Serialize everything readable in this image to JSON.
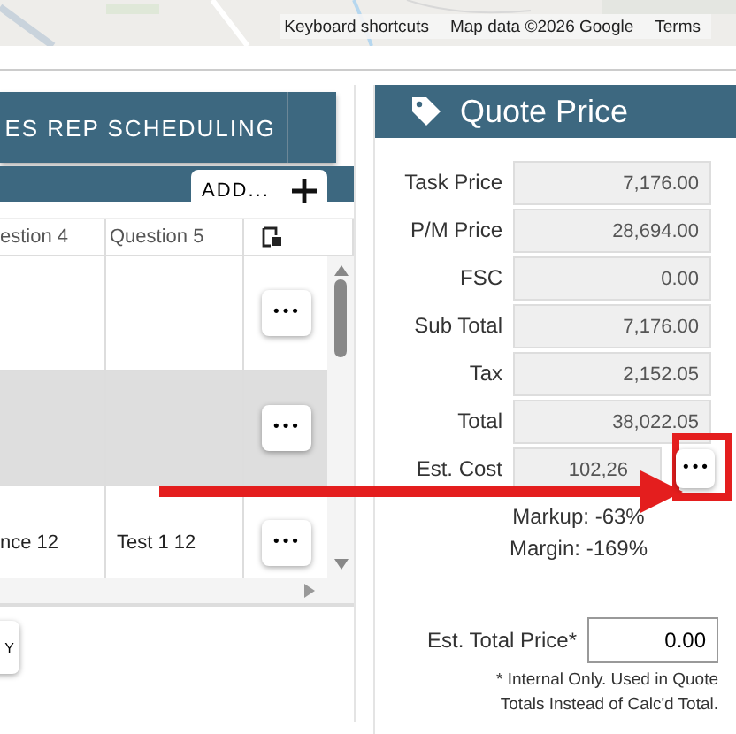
{
  "map": {
    "kind": "picture",
    "attribution": [
      "Keyboard shortcuts",
      "Map data ©2026 Google",
      "Terms"
    ]
  },
  "left_panel": {
    "tabs": [
      {
        "label": "ES REP SCHEDULING",
        "selected": true
      }
    ],
    "add_button": "ADD...",
    "table": {
      "columns": [
        "estion 4",
        "Question 5"
      ],
      "rows": [
        {
          "cells": [
            null,
            null
          ],
          "shaded": false
        },
        {
          "cells": [
            null,
            null
          ],
          "shaded": true
        },
        {
          "cells": [
            "nce 12",
            "Test 1 12"
          ],
          "shaded": false
        }
      ],
      "row_button": "•••"
    },
    "bottom_button": "Y"
  },
  "quote_price": {
    "title": "Quote Price",
    "fields": [
      {
        "label": "Task Price",
        "value": "7,176.00"
      },
      {
        "label": "P/M Price",
        "value": "28,694.00"
      },
      {
        "label": "FSC",
        "value": "0.00"
      },
      {
        "label": "Sub Total",
        "value": "7,176.00"
      },
      {
        "label": "Tax",
        "value": "2,152.05"
      },
      {
        "label": "Total",
        "value": "38,022.05"
      }
    ],
    "est_cost": {
      "label": "Est. Cost",
      "value": "102,26",
      "button": "•••"
    },
    "markup": "Markup: -63%",
    "margin": "Margin: -169%",
    "est_total_price": {
      "label": "Est. Total Price*",
      "value": "0.00"
    },
    "footnote": [
      "* Internal Only. Used in Quote",
      "Totals Instead of Calc'd Total."
    ]
  }
}
